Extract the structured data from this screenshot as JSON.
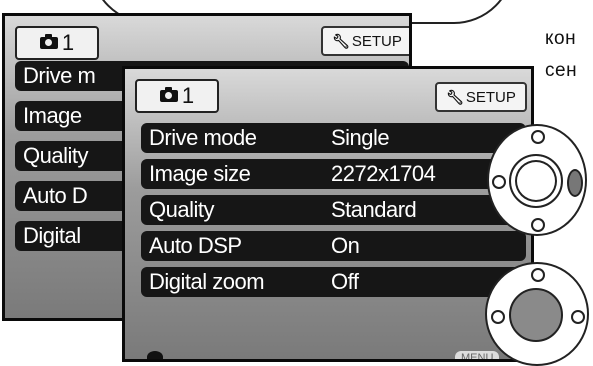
{
  "side_text": {
    "line1": "кон",
    "line2": "сен"
  },
  "back_menu": {
    "tab_number": "1",
    "setup_label": "SETUP",
    "rows": [
      {
        "label": "Drive m"
      },
      {
        "label": "Image"
      },
      {
        "label": "Quality"
      },
      {
        "label": "Auto D"
      },
      {
        "label": "Digital"
      }
    ]
  },
  "front_menu": {
    "tab_number": "1",
    "setup_label": "SETUP",
    "rows": [
      {
        "label": "Drive mode",
        "value": "Single"
      },
      {
        "label": "Image size",
        "value": "2272x1704"
      },
      {
        "label": "Quality",
        "value": "Standard"
      },
      {
        "label": "Auto DSP",
        "value": "On"
      },
      {
        "label": "Digital zoom",
        "value": "Off"
      }
    ],
    "footer_button": "MENU"
  },
  "icons": {
    "tab": "camera-icon",
    "setup": "wrench-icon",
    "controller_top": "controller-right-pressed-icon",
    "controller_bottom": "controller-center-pressed-icon"
  }
}
